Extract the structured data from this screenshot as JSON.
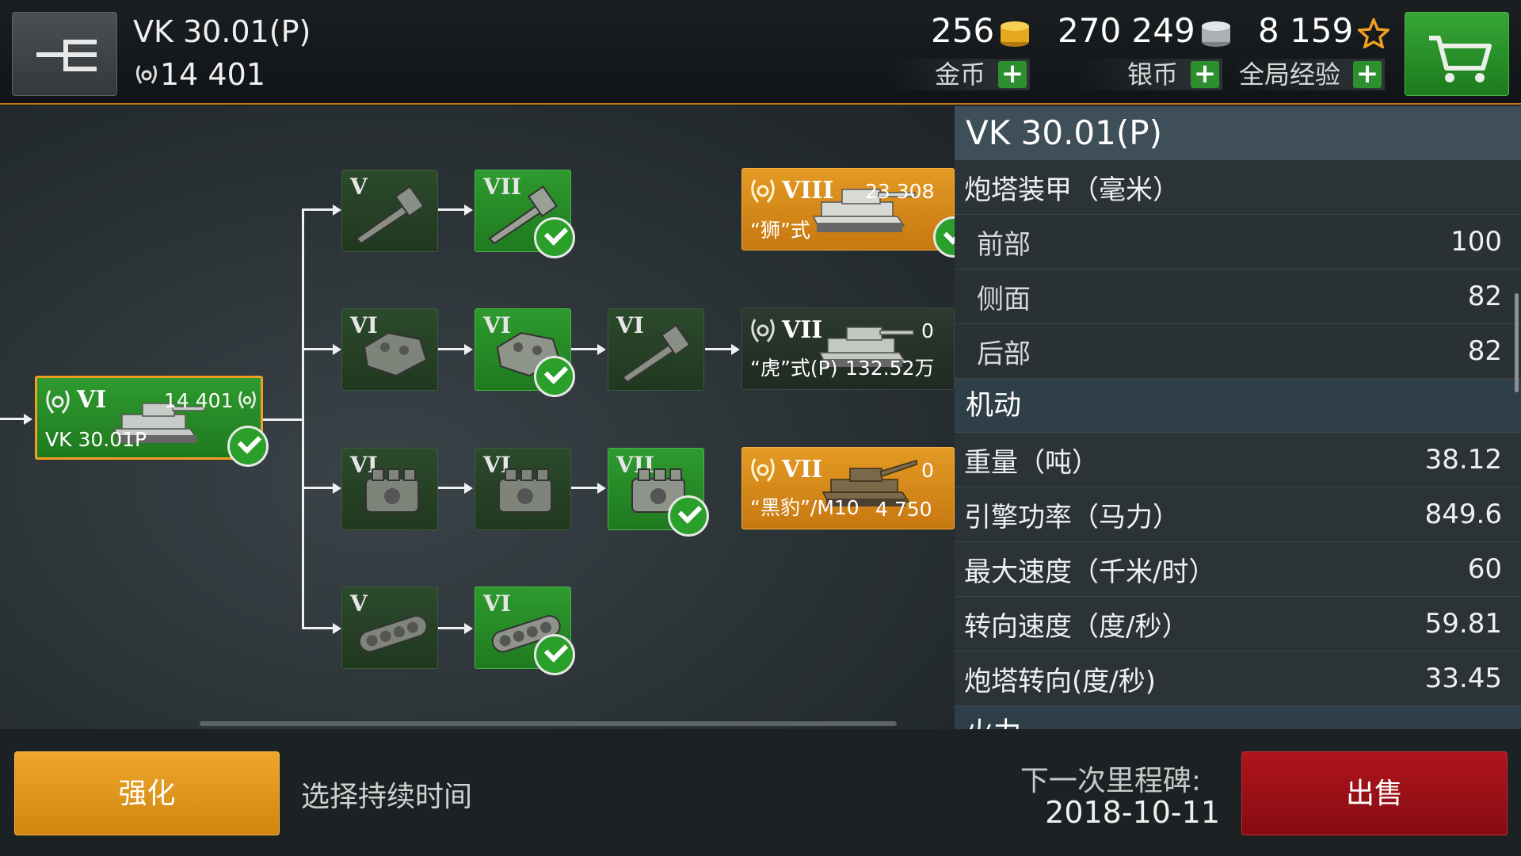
{
  "header": {
    "vehicle_name": "VK 30.01(P)",
    "vehicle_xp": "14 401",
    "gold": "256",
    "silver": "270 249",
    "free_xp": "8 159",
    "gold_label": "金币",
    "silver_label": "银币",
    "free_xp_label": "全局经验"
  },
  "tree": {
    "current": {
      "tier": "VI",
      "xp": "14 401",
      "name": "VK 30.01P"
    },
    "modules": {
      "r1a": "V",
      "r1b": "VII",
      "r2a": "VI",
      "r2b": "VI",
      "r2c": "VI",
      "r3a": "VI",
      "r3b": "VI",
      "r3c": "VII",
      "r4a": "V",
      "r4b": "VI"
    },
    "next1": {
      "tier": "VIII",
      "xp": "23 308",
      "name": "“狮”式"
    },
    "next2": {
      "tier": "VII",
      "xp": "0",
      "name": "“虎”式(P)",
      "cost": "132.52万"
    },
    "next3": {
      "tier": "VII",
      "xp": "0",
      "name": "“黑豹”/M10",
      "cost": "4 750"
    }
  },
  "stats": {
    "title": "VK 30.01(P)",
    "armor_header": "炮塔装甲（毫米）",
    "armor": [
      {
        "label": "前部",
        "value": "100"
      },
      {
        "label": "侧面",
        "value": "82"
      },
      {
        "label": "后部",
        "value": "82"
      }
    ],
    "mobility_header": "机动",
    "mobility": [
      {
        "label": "重量（吨）",
        "value": "38.12"
      },
      {
        "label": "引擎功率（马力）",
        "value": "849.6"
      },
      {
        "label": "最大速度（千米/时）",
        "value": "60"
      },
      {
        "label": "转向速度（度/秒）",
        "value": "59.81"
      },
      {
        "label": "炮塔转向(度/秒)",
        "value": "33.45"
      }
    ],
    "firepower_header": "火力"
  },
  "footer": {
    "upgrade_label": "强化",
    "duration_label": "选择持续时间",
    "milestone_label": "下一次里程碑:",
    "milestone_date": "2018-10-11",
    "sell_label": "出售"
  }
}
